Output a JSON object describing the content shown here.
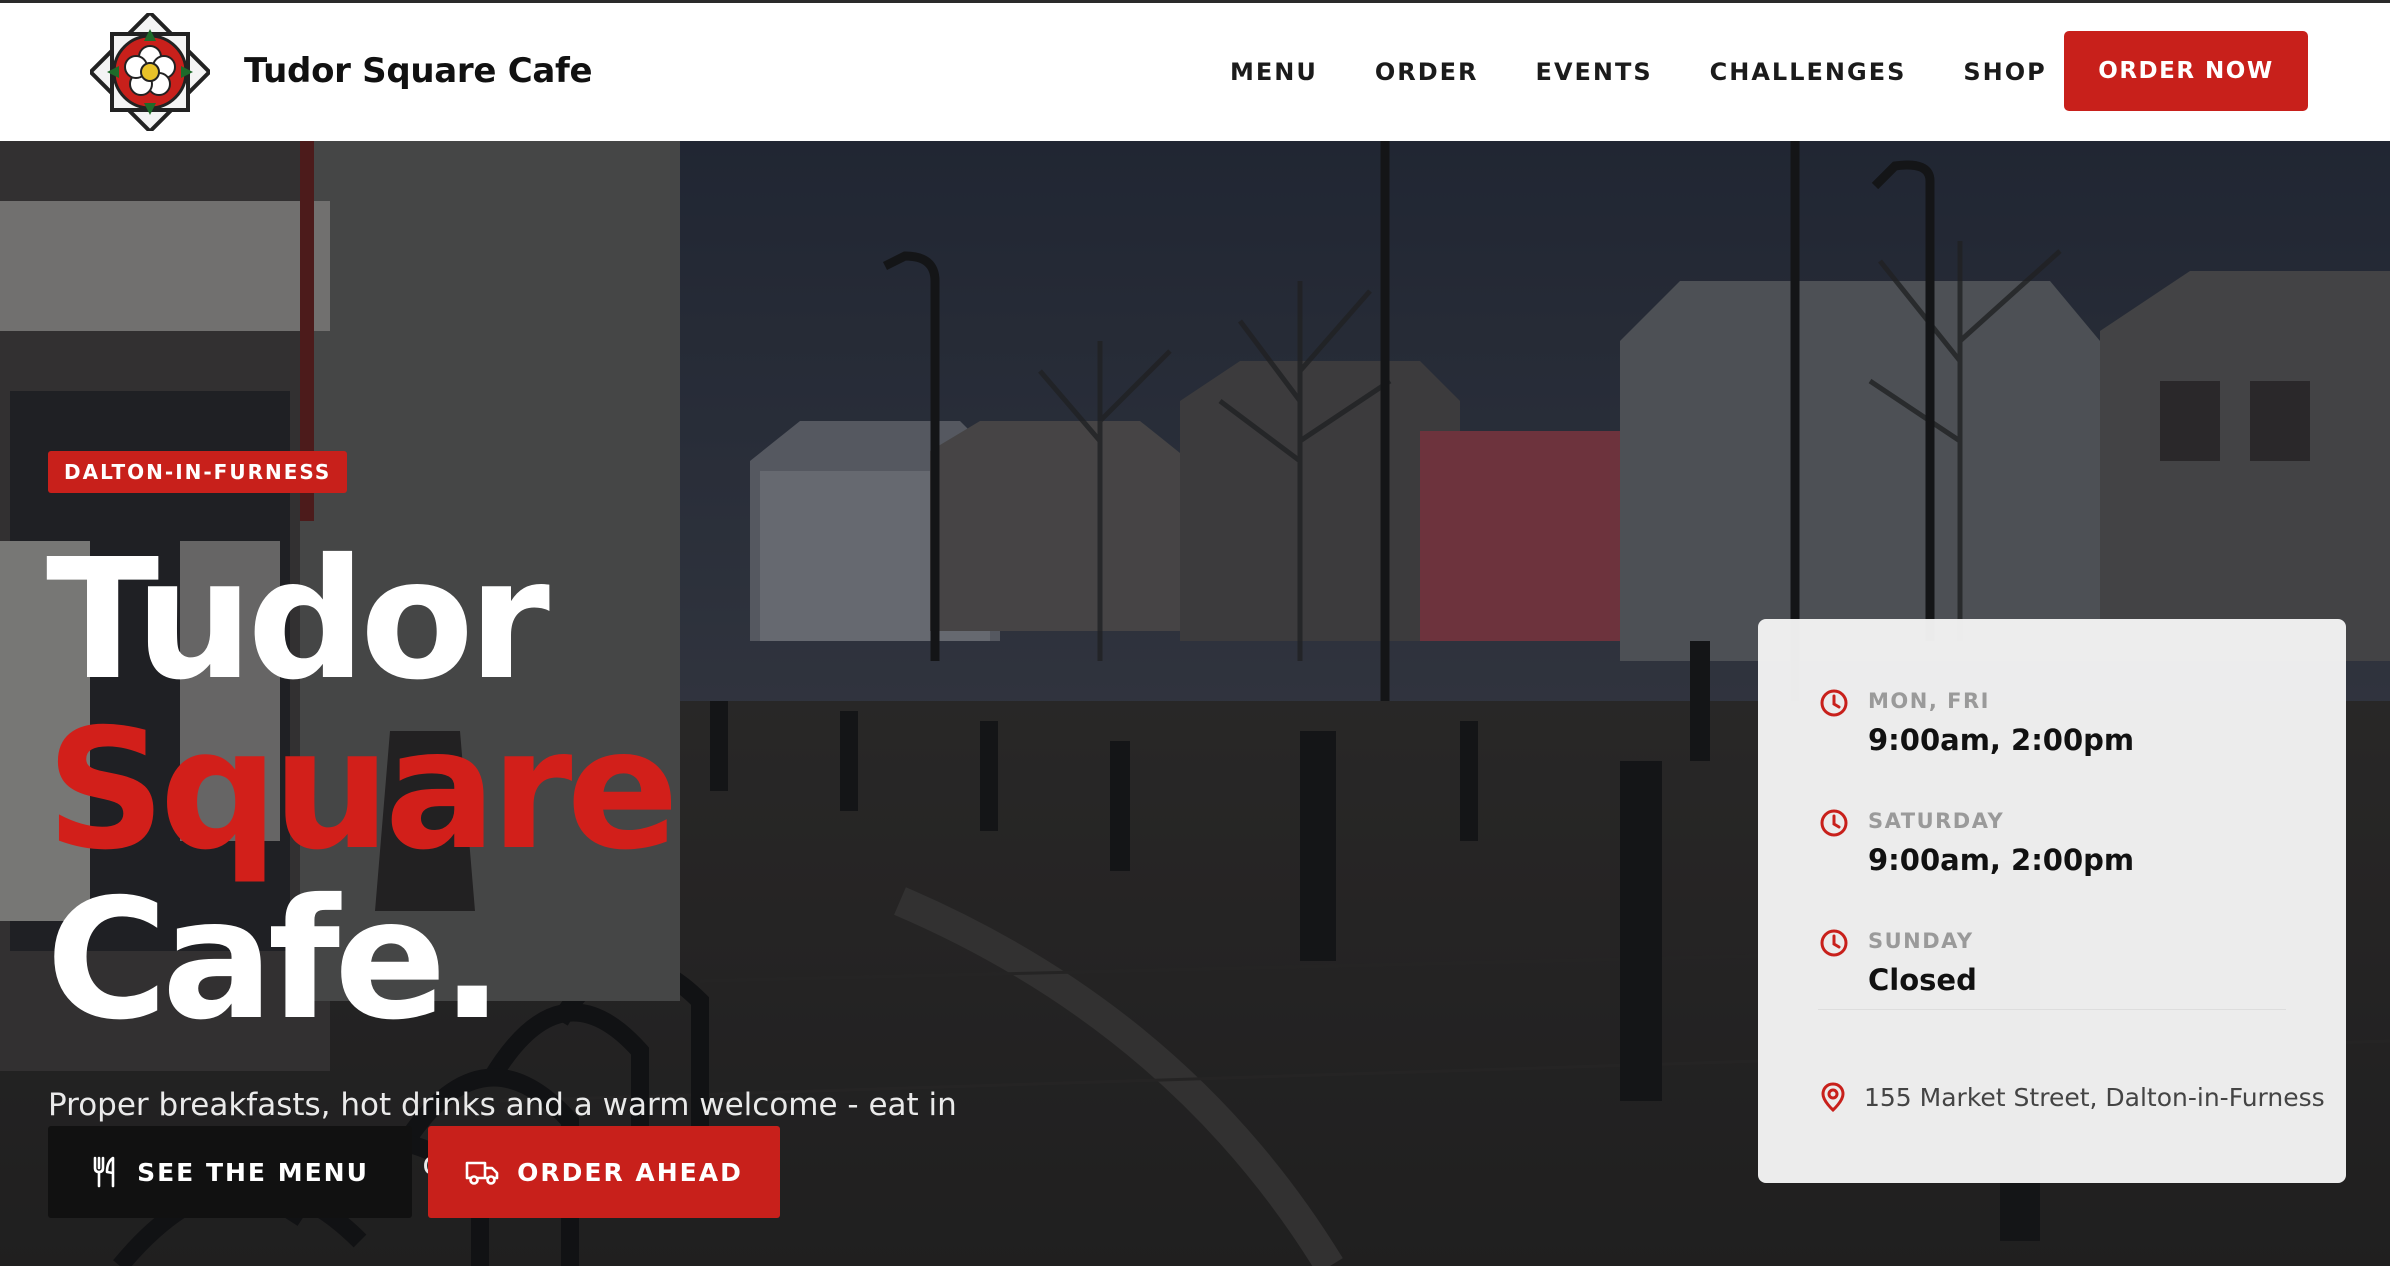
{
  "header": {
    "brand": "Tudor Square Cafe",
    "logo_icon": "tudor-rose-icon",
    "nav": [
      "MENU",
      "ORDER",
      "EVENTS",
      "CHALLENGES",
      "SHOP"
    ],
    "cta_label": "ORDER NOW"
  },
  "hero": {
    "tag": "DALTON-IN-FURNESS",
    "headline": [
      "Tudor",
      "Square",
      "Cafe."
    ],
    "subtext": "Proper breakfasts, hot drinks and a warm welcome - eat in or takeaway, every day of the week.",
    "buttons": {
      "menu_label": "SEE THE MENU",
      "menu_icon": "cutlery-icon",
      "order_label": "ORDER AHEAD",
      "order_icon": "delivery-truck-icon"
    }
  },
  "hours": {
    "rows": [
      {
        "day": "MON, FRI",
        "time": "9:00am, 2:00pm"
      },
      {
        "day": "SATURDAY",
        "time": "9:00am, 2:00pm"
      },
      {
        "day": "SUNDAY",
        "time": "Closed"
      }
    ],
    "address": "155 Market Street, Dalton-in-Furness",
    "row_icon": "clock-icon",
    "address_icon": "map-pin-icon"
  },
  "colors": {
    "accent": "#c8201b",
    "dark": "#111111",
    "overlay": "#1b1d22"
  }
}
